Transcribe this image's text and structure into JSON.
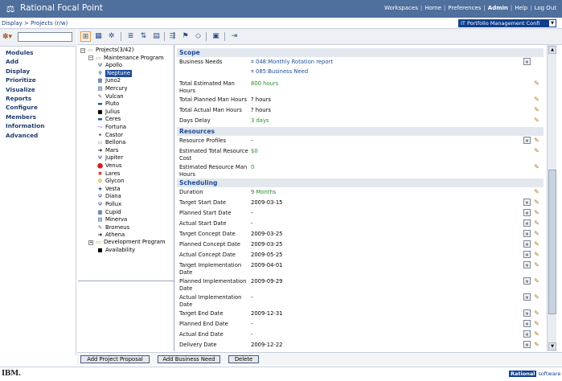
{
  "app": {
    "title": "Rational Focal Point"
  },
  "topnav": [
    {
      "label": "Workspaces",
      "bold": false
    },
    {
      "label": "Home",
      "bold": false
    },
    {
      "label": "Preferences",
      "bold": false
    },
    {
      "label": "Admin",
      "bold": true
    },
    {
      "label": "Help",
      "bold": false
    },
    {
      "label": "Log Out",
      "bold": false
    }
  ],
  "breadcrumb": {
    "text": "Display > Projects (r/w)"
  },
  "workspace_select": {
    "value": "IT Portfolio Management Confi"
  },
  "sidebar": {
    "menu": [
      "Modules",
      "Add",
      "Display",
      "Prioritize",
      "Visualize",
      "Reports",
      "Configure",
      "Members",
      "Information",
      "Advanced"
    ]
  },
  "toolbar": {
    "icons": [
      "tree-view-icon",
      "table-view-icon",
      "hierarchy-icon",
      "bar-chart-icon",
      "sort-icon",
      "filter-icon",
      "compare-icon",
      "flag-icon",
      "diamond-icon",
      "page-icon",
      "export-icon"
    ]
  },
  "tree": {
    "root": "Projects(3/42)",
    "group1": "Maintenance Program",
    "items": [
      {
        "label": "Apollo",
        "glyph": "Ψ",
        "color": "#2b4c8c"
      },
      {
        "label": "Neptune",
        "glyph": "♆",
        "color": "#ffffff",
        "selected": true
      },
      {
        "label": "Juno2",
        "glyph": "▦",
        "color": "#2b4c8c"
      },
      {
        "label": "Mercury",
        "glyph": "▤",
        "color": "#2b4c8c"
      },
      {
        "label": "Vulcan",
        "glyph": "✎",
        "color": "#555"
      },
      {
        "label": "Pluto",
        "glyph": "▬",
        "color": "#1f4d99"
      },
      {
        "label": "Julius",
        "glyph": "■",
        "color": "#000"
      },
      {
        "label": "Ceres",
        "glyph": "▬",
        "color": "#1f4d99"
      },
      {
        "label": "Fortuna",
        "glyph": "〜",
        "color": "#3a6ad0"
      },
      {
        "label": "Castor",
        "glyph": "✦",
        "color": "#555"
      },
      {
        "label": "Bellona",
        "glyph": "▭",
        "color": "#888"
      },
      {
        "label": "Mars",
        "glyph": "➜",
        "color": "#000"
      },
      {
        "label": "Jupiter",
        "glyph": "Ψ",
        "color": "#2b4c8c"
      },
      {
        "label": "Venus",
        "glyph": "⬤",
        "color": "#d02020"
      },
      {
        "label": "Lares",
        "glyph": "✖",
        "color": "#d02020"
      },
      {
        "label": "Glycon",
        "glyph": "✿",
        "color": "#d0a020"
      },
      {
        "label": "Vesta",
        "glyph": "★",
        "color": "#1f4d99"
      },
      {
        "label": "Diana",
        "glyph": "Ψ",
        "color": "#2b4c8c"
      },
      {
        "label": "Pollux",
        "glyph": "Ψ",
        "color": "#2b4c8c"
      },
      {
        "label": "Cupid",
        "glyph": "▦",
        "color": "#2b4c8c"
      },
      {
        "label": "Minerva",
        "glyph": "▤",
        "color": "#2b4c8c"
      },
      {
        "label": "Bromeus",
        "glyph": "✎",
        "color": "#555"
      },
      {
        "label": "Athena",
        "glyph": "➜",
        "color": "#000"
      }
    ],
    "group2": "Development Program",
    "availability": "Availability"
  },
  "scope": {
    "heading": "Scope",
    "business_needs_label": "Business Needs",
    "business_needs": [
      "048:Monthly Rotation report",
      "085:Business Need"
    ],
    "fields": [
      {
        "label": "Total Estimated Man Hours",
        "value": "800 hours",
        "green": true
      },
      {
        "label": "Total Planned Man Hours",
        "value": "? hours",
        "green": false
      },
      {
        "label": "Total Actual Man Hours",
        "value": "? hours",
        "green": false
      },
      {
        "label": "Days Delay",
        "value": "3 days",
        "green": true
      }
    ]
  },
  "resources": {
    "heading": "Resources",
    "fields": [
      {
        "label": "Resource Profiles",
        "value": "-",
        "green": false
      },
      {
        "label": "Estimated Total Resource Cost",
        "value": "$0",
        "green": true
      },
      {
        "label": "Estimated Resource Man Hours",
        "value": "0",
        "green": true
      }
    ]
  },
  "scheduling": {
    "heading": "Scheduling",
    "fields": [
      {
        "label": "Duration",
        "value": "9 Months",
        "green": true
      },
      {
        "label": "Target Start Date",
        "value": "2009-03-15",
        "green": false
      },
      {
        "label": "Planned Start Date",
        "value": "-",
        "green": false
      },
      {
        "label": "Actual Start Date",
        "value": "-",
        "green": false
      },
      {
        "label": "Target Concept Date",
        "value": "2009-03-25",
        "green": false
      },
      {
        "label": "Planned Concept Date",
        "value": "2009-03-25",
        "green": false
      },
      {
        "label": "Actual Concept Date",
        "value": "2009-05-25",
        "green": false
      },
      {
        "label": "Target Implementation Date",
        "value": "2009-04-01",
        "green": false
      },
      {
        "label": "Planned Implementation Date",
        "value": "2009-09-29",
        "green": false
      },
      {
        "label": "Actual Implementation Date",
        "value": "-",
        "green": false
      },
      {
        "label": "Target End Date",
        "value": "2009-12-31",
        "green": false
      },
      {
        "label": "Planned End Date",
        "value": "-",
        "green": false
      },
      {
        "label": "Actual End Date",
        "value": "-",
        "green": false
      },
      {
        "label": "Delivery Date",
        "value": "2009-12-22",
        "green": false
      }
    ]
  },
  "buttons": {
    "add_project_proposal": "Add Project Proposal",
    "add_business_need": "Add Business Need",
    "delete": "Delete"
  },
  "footer": {
    "ibm": "IBM.",
    "rational": "Rational",
    "software": "software"
  }
}
